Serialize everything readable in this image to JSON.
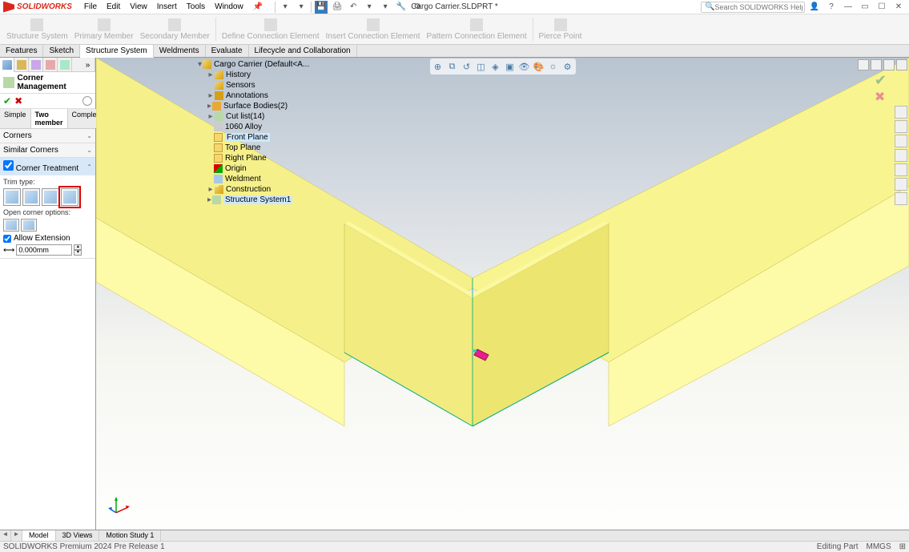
{
  "app": {
    "name": "SOLIDWORKS",
    "doc_title": "Cargo Carrier.SLDPRT *"
  },
  "menu": [
    "File",
    "Edit",
    "View",
    "Insert",
    "Tools",
    "Window"
  ],
  "search": {
    "placeholder": "Search SOLIDWORKS Help"
  },
  "ribbon": [
    {
      "label": "Structure\nSystem"
    },
    {
      "label": "Primary\nMember"
    },
    {
      "label": "Secondary\nMember"
    },
    {
      "label": "Define\nConnection\nElement"
    },
    {
      "label": "Insert\nConnection\nElement"
    },
    {
      "label": "Pattern\nConnection\nElement"
    },
    {
      "label": "Pierce\nPoint"
    }
  ],
  "cmd_tabs": [
    "Features",
    "Sketch",
    "Structure System",
    "Weldments",
    "Evaluate",
    "Lifecycle and Collaboration"
  ],
  "cmd_active": "Structure System",
  "pm": {
    "title": "Corner Management",
    "subtabs": [
      "Simple",
      "Two member",
      "Complex"
    ],
    "subtab_active": "Two member",
    "section_corners": "Corners",
    "section_similar": "Similar Corners",
    "section_treatment": "Corner Treatment",
    "trim_type_label": "Trim type:",
    "open_corner_label": "Open corner options:",
    "allow_ext": "Allow Extension",
    "offset_value": "0.000mm"
  },
  "tree": {
    "root": "Cargo Carrier  (Default<A...",
    "items": [
      {
        "label": "History",
        "ico": "folder",
        "exp": "▸"
      },
      {
        "label": "Sensors",
        "ico": "folder",
        "exp": ""
      },
      {
        "label": "Annotations",
        "ico": "note",
        "exp": "▸"
      },
      {
        "label": "Surface Bodies(2)",
        "ico": "surf",
        "exp": "▸"
      },
      {
        "label": "Cut list(14)",
        "ico": "cut",
        "exp": "▸"
      },
      {
        "label": "1060 Alloy",
        "ico": "mat",
        "exp": ""
      },
      {
        "label": "Front Plane",
        "ico": "plane",
        "exp": "",
        "hilite": true
      },
      {
        "label": "Top Plane",
        "ico": "plane",
        "exp": ""
      },
      {
        "label": "Right Plane",
        "ico": "plane",
        "exp": ""
      },
      {
        "label": "Origin",
        "ico": "origin",
        "exp": ""
      },
      {
        "label": "Weldment",
        "ico": "weld",
        "exp": ""
      },
      {
        "label": "Construction",
        "ico": "folder",
        "exp": "▸"
      },
      {
        "label": "Structure System1",
        "ico": "struct",
        "exp": "▸",
        "hilite": true
      }
    ]
  },
  "bottom_tabs": [
    "Model",
    "3D Views",
    "Motion Study 1"
  ],
  "bottom_active": "Model",
  "status": {
    "left": "SOLIDWORKS Premium 2024 Pre Release 1",
    "edit": "Editing Part",
    "units": "MMGS"
  }
}
